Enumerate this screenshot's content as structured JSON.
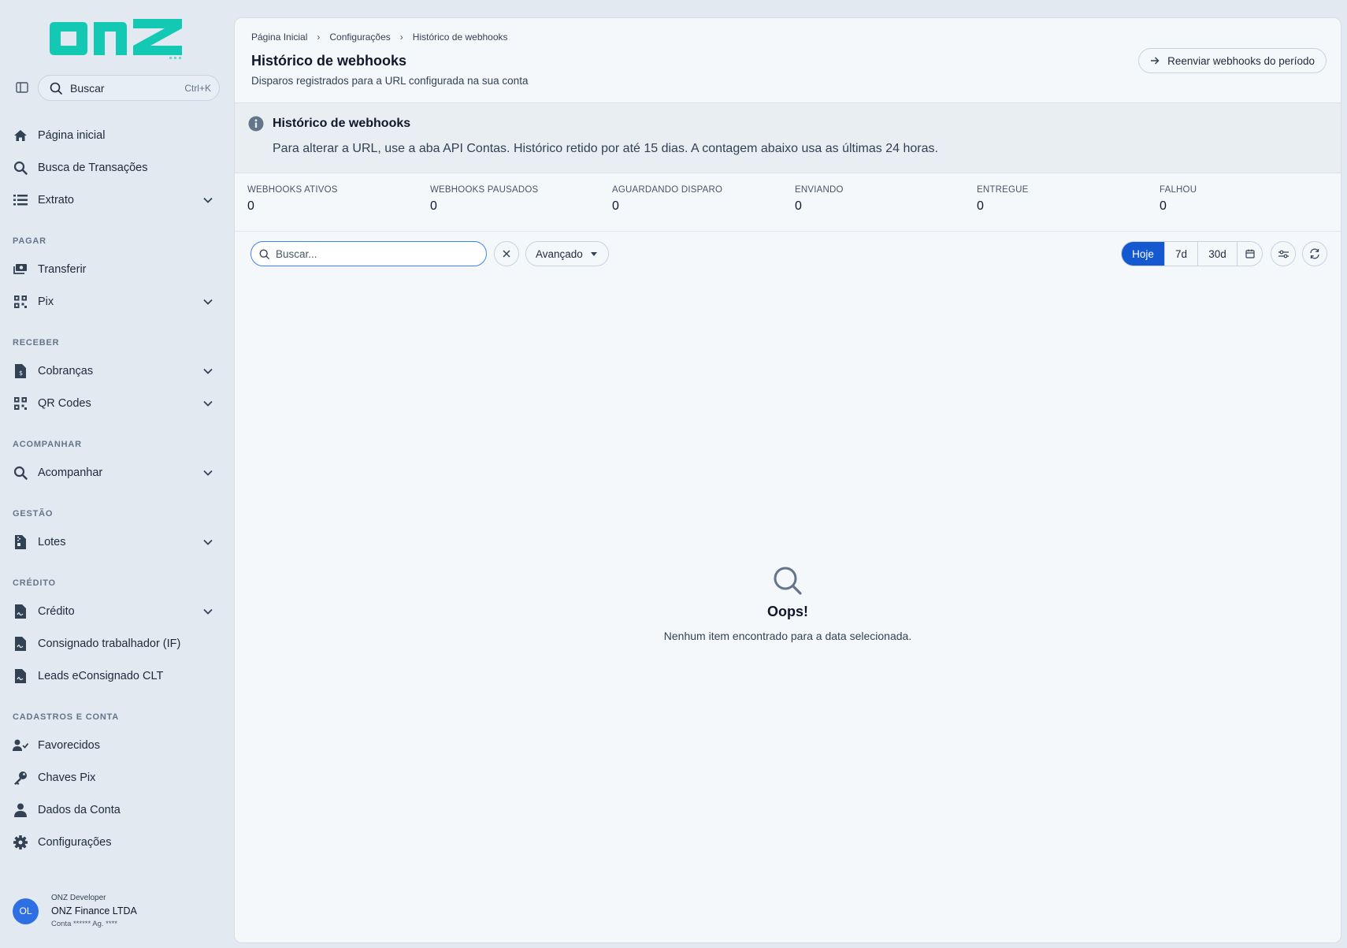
{
  "brand": {
    "logo_text": "onz",
    "accent": "#14c9b4"
  },
  "sidebar": {
    "search_label": "Buscar",
    "search_shortcut": "Ctrl+K",
    "items_top": [
      {
        "label": "Página inicial",
        "icon": "home-icon"
      },
      {
        "label": "Busca de Transações",
        "icon": "search-icon"
      },
      {
        "label": "Extrato",
        "icon": "list-icon"
      }
    ],
    "sections": {
      "pagar": "PAGAR",
      "receber": "RECEBER",
      "acompanhar": "ACOMPANHAR",
      "gestao": "GESTÃO",
      "credito": "CRÉDITO",
      "cadastros": "CADASTROS E CONTA"
    },
    "items": {
      "transferir": "Transferir",
      "pix": "Pix",
      "cobrancas": "Cobranças",
      "qrcodes": "QR Codes",
      "acompanhar": "Acompanhar",
      "lotes": "Lotes",
      "credito": "Crédito",
      "consignado": "Consignado trabalhador (IF)",
      "leads": "Leads eConsignado CLT",
      "favorecidos": "Favorecidos",
      "chaves_pix": "Chaves Pix",
      "dados_conta": "Dados da Conta",
      "configuracoes": "Configurações"
    },
    "user": {
      "initials": "OL",
      "role": "ONZ Developer",
      "company": "ONZ Finance LTDA",
      "account": "Conta ****** Ag. ****"
    }
  },
  "main": {
    "breadcrumb": [
      "Página Inicial",
      "Configurações",
      "Histórico de webhooks"
    ],
    "title": "Histórico de webhooks",
    "subtitle": "Disparos registrados para a URL configurada na sua conta",
    "resend_button": "Reenviar webhooks do período",
    "banner": {
      "title": "Histórico de webhooks",
      "text": "Para alterar a URL, use a aba API Contas. Histórico retido por até 15 dias. A contagem abaixo usa as últimas 24 horas."
    },
    "stats": [
      {
        "label": "WEBHOOKS ATIVOS",
        "value": "0"
      },
      {
        "label": "WEBHOOKS PAUSADOS",
        "value": "0"
      },
      {
        "label": "AGUARDANDO DISPARO",
        "value": "0"
      },
      {
        "label": "ENVIANDO",
        "value": "0"
      },
      {
        "label": "ENTREGUE",
        "value": "0"
      },
      {
        "label": "FALHOU",
        "value": "0"
      }
    ],
    "toolbar": {
      "search_placeholder": "Buscar...",
      "search_value": "",
      "advanced_label": "Avançado",
      "ranges": [
        "Hoje",
        "7d",
        "30d"
      ],
      "active_range": "Hoje"
    },
    "empty": {
      "title": "Oops!",
      "message": "Nenhum item encontrado para a data selecionada."
    }
  }
}
